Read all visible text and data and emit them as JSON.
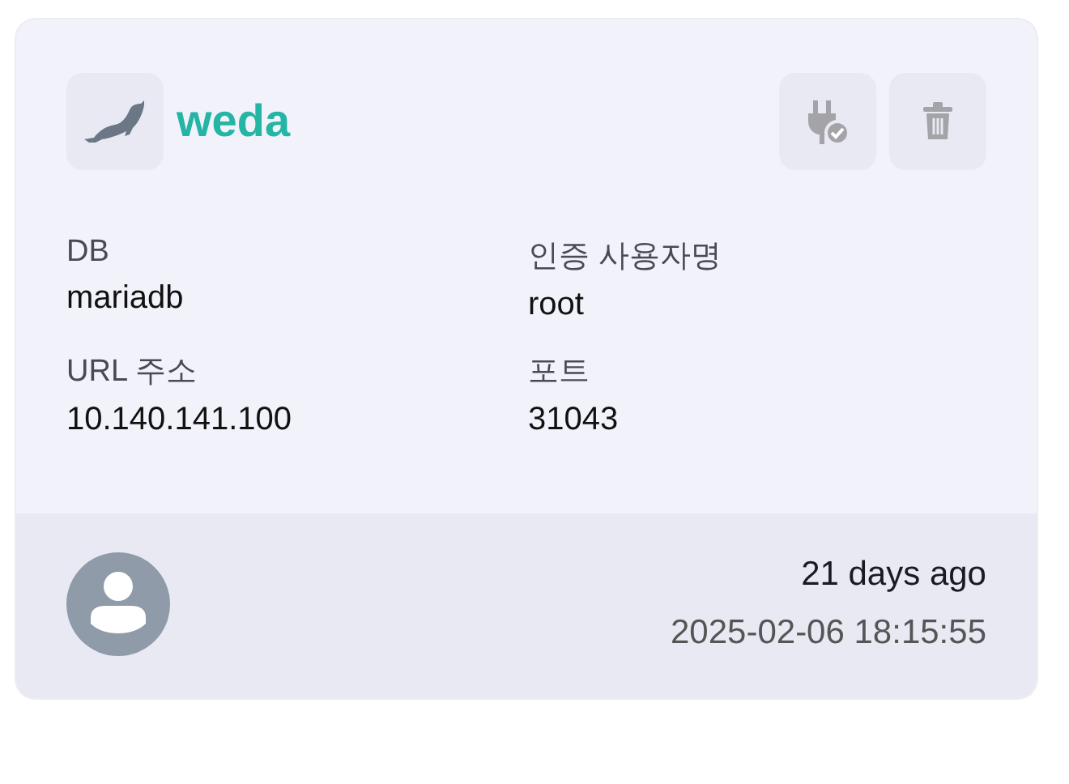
{
  "card": {
    "name": "weda",
    "fields": [
      {
        "label": "DB",
        "value": "mariadb"
      },
      {
        "label": "인증 사용자명",
        "value": "root"
      },
      {
        "label": "URL 주소",
        "value": "10.140.141.100"
      },
      {
        "label": "포트",
        "value": "31043"
      }
    ],
    "footer": {
      "relative_time": "21 days ago",
      "timestamp": "2025-02-06 18:15:55"
    }
  }
}
